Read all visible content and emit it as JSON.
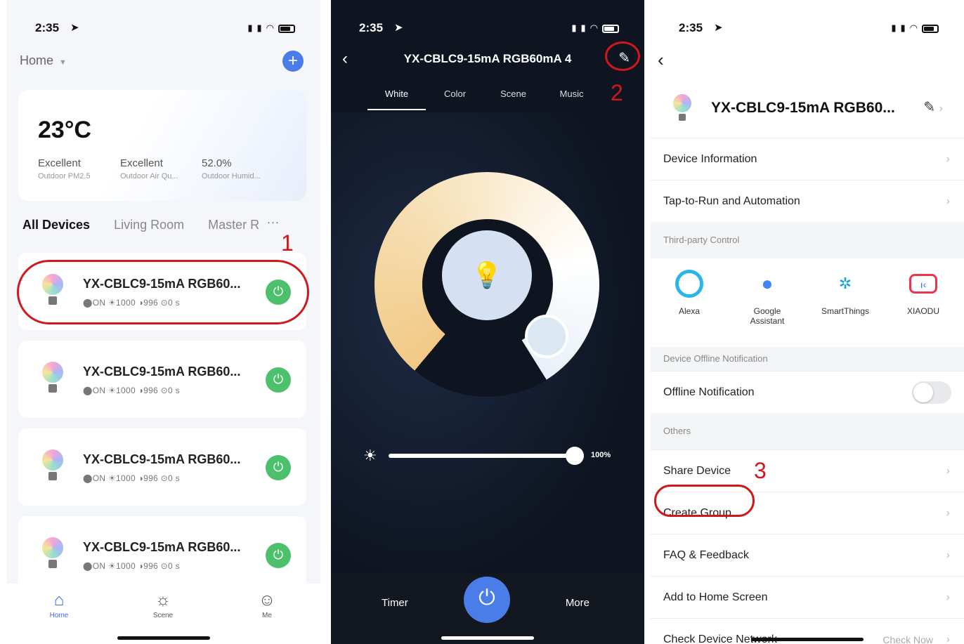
{
  "status": {
    "time": "2:35"
  },
  "home": {
    "home_selector": "Home",
    "weather": {
      "temperature": "23°C",
      "stats": [
        {
          "value": "Excellent",
          "label": "Outdoor PM2.5"
        },
        {
          "value": "Excellent",
          "label": "Outdoor Air Qu..."
        },
        {
          "value": "52.0%",
          "label": "Outdoor Humid..."
        }
      ]
    },
    "rooms": [
      "All Devices",
      "Living Room",
      "Master R"
    ],
    "rooms_more": "···",
    "devices": [
      {
        "name": "YX-CBLC9-15mA RGB60...",
        "meta": "⬤ON  ☀1000  ◑996  ⊙0 s"
      },
      {
        "name": "YX-CBLC9-15mA RGB60...",
        "meta": "⬤ON  ☀1000  ◑996  ⊙0 s"
      },
      {
        "name": "YX-CBLC9-15mA RGB60...",
        "meta": "⬤ON  ☀1000  ◑996  ⊙0 s"
      },
      {
        "name": "YX-CBLC9-15mA RGB60...",
        "meta": "⬤ON  ☀1000  ◑996  ⊙0 s"
      }
    ],
    "tabbar": [
      {
        "label": "Home",
        "icon": "house-icon"
      },
      {
        "label": "Scene",
        "icon": "sun-icon"
      },
      {
        "label": "Me",
        "icon": "person-icon"
      }
    ]
  },
  "control": {
    "title": "YX-CBLC9-15mA RGB60mA 4",
    "tabs": [
      "White",
      "Color",
      "Scene",
      "Music"
    ],
    "active_tab": "White",
    "brightness_label": "100%",
    "brightness": 1.0,
    "timer_label": "Timer",
    "more_label": "More"
  },
  "settings": {
    "device_name": "YX-CBLC9-15mA RGB60...",
    "rows_top": [
      "Device Information",
      "Tap-to-Run and Automation"
    ],
    "third_party_header": "Third-party Control",
    "third_party": [
      {
        "label": "Alexa",
        "icon": "alexa-icon"
      },
      {
        "label": "Google\nAssistant",
        "icon": "google-assistant-icon"
      },
      {
        "label": "SmartThings",
        "icon": "smartthings-icon"
      },
      {
        "label": "XIAODU",
        "icon": "xiaodu-icon"
      }
    ],
    "offline_header": "Device Offline Notification",
    "offline_label": "Offline Notification",
    "others_header": "Others",
    "rows_others": [
      "Share Device",
      "Create Group",
      "FAQ & Feedback",
      "Add to Home Screen",
      "Check Device Network"
    ],
    "check_now": "Check Now"
  },
  "annotations": [
    "1",
    "2",
    "3"
  ],
  "colors": {
    "accent": "#4a7de8",
    "power_green": "#4cc06b",
    "annotation_red": "#d0171c"
  }
}
